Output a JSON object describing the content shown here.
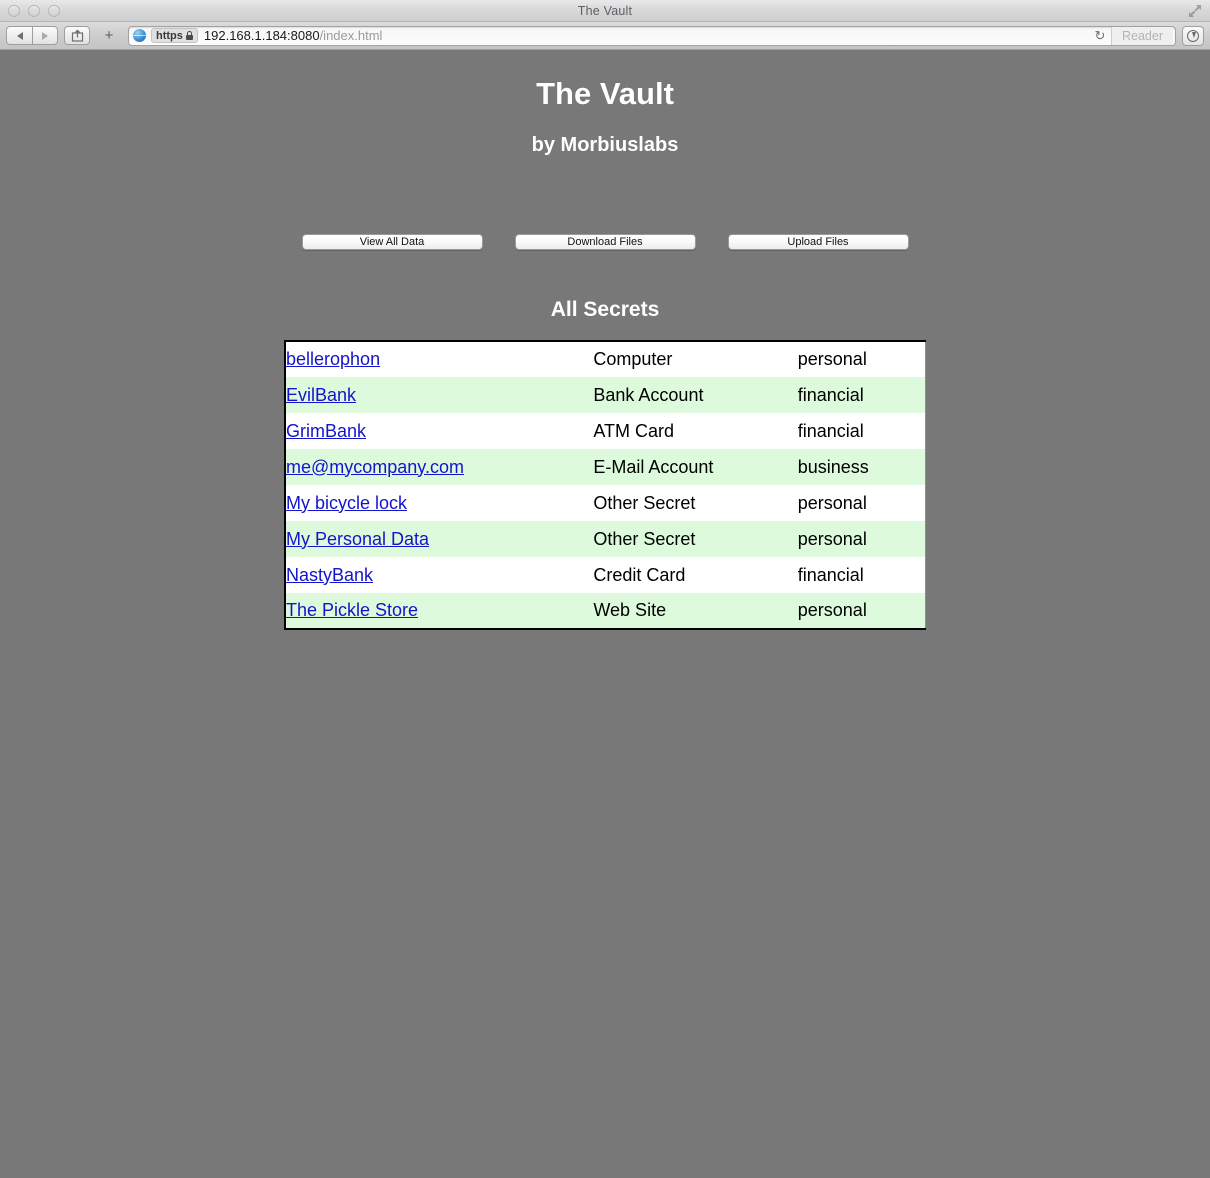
{
  "window": {
    "title": "The Vault",
    "traffic_lights": [
      "close",
      "minimize",
      "zoom"
    ],
    "fullscreen_icon": "fullscreen-arrows-icon"
  },
  "toolbar": {
    "back_icon": "back-arrow-icon",
    "forward_icon": "forward-arrow-icon",
    "share_icon": "share-icon",
    "add_tab_label": "+",
    "site_icon": "globe-icon",
    "security_badge": "https",
    "lock_icon": "lock-icon",
    "url_host": "192.168.1.184:8080",
    "url_path": "/index.html",
    "reload_icon": "reload-icon",
    "reader_label": "Reader",
    "downloads_icon": "downloads-icon"
  },
  "page": {
    "title": "The Vault",
    "subtitle": "by Morbiuslabs",
    "section_title": "All Secrets",
    "buttons": [
      {
        "label": "View All Data"
      },
      {
        "label": "Download Files"
      },
      {
        "label": "Upload Files"
      }
    ],
    "table": {
      "rows": [
        {
          "name": "bellerophon",
          "type": "Computer",
          "category": "personal"
        },
        {
          "name": "EvilBank",
          "type": "Bank Account",
          "category": "financial"
        },
        {
          "name": "GrimBank",
          "type": "ATM Card",
          "category": "financial"
        },
        {
          "name": "me@mycompany.com",
          "type": "E-Mail Account",
          "category": "business"
        },
        {
          "name": "My bicycle lock",
          "type": "Other Secret",
          "category": "personal"
        },
        {
          "name": "My Personal Data",
          "type": "Other Secret",
          "category": "personal"
        },
        {
          "name": "NastyBank",
          "type": "Credit Card",
          "category": "financial"
        },
        {
          "name": "The Pickle Store",
          "type": "Web Site",
          "category": "personal"
        }
      ]
    }
  },
  "colors": {
    "page_background": "#787878",
    "row_alt_background": "#ddfadd",
    "link": "#1414cc",
    "heading_text": "#ffffff"
  }
}
